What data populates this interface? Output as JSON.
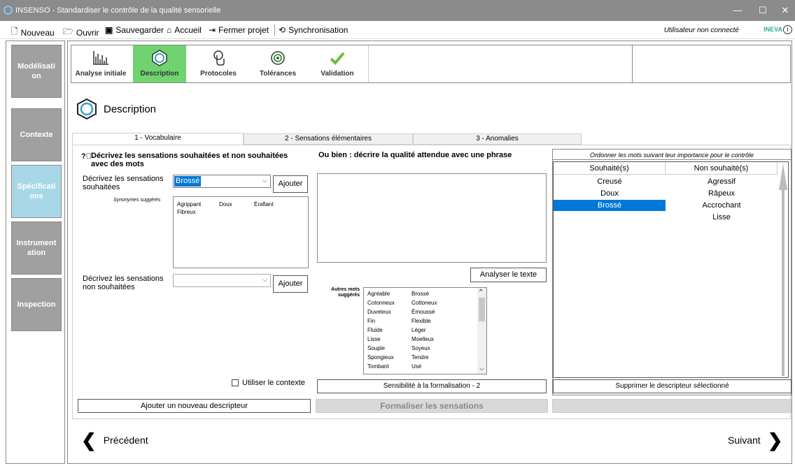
{
  "window": {
    "title": "INSENSO - Standardiser le contrôle de la qualité sensorielle"
  },
  "menu": {
    "new": "Nouveau",
    "open": "Ouvrir",
    "save": "Sauvegarder",
    "home": "Accueil",
    "close_project": "Fermer projet",
    "sync": "Synchronisation",
    "user_status": "Utilisateur non connecté",
    "brand": "INEVA"
  },
  "sidebar": {
    "items": [
      {
        "label": "Modélisati on"
      },
      {
        "label": "Contexte"
      },
      {
        "label": "Spécificati ons"
      },
      {
        "label": "Instrument ation"
      },
      {
        "label": "Inspection"
      }
    ]
  },
  "toolbar": {
    "items": [
      {
        "label": "Analyse initiale",
        "icon": "analysis-icon"
      },
      {
        "label": "Description",
        "icon": "description-icon",
        "active": true
      },
      {
        "label": "Protocoles",
        "icon": "touch-icon"
      },
      {
        "label": "Tolérances",
        "icon": "target-icon"
      },
      {
        "label": "Validation",
        "icon": "check-icon"
      }
    ]
  },
  "page": {
    "title": "Description"
  },
  "tabs": [
    {
      "label": "1 - Vocabulaire",
      "active": true
    },
    {
      "label": "2 - Sensations élémentaires"
    },
    {
      "label": "3 - Anomalies"
    }
  ],
  "vocab": {
    "heading": "Décrivez les sensations souhaitées et non souhaitées avec des mots",
    "desired_label": "Décrivez les sensations souhaitées",
    "desired_value": "Brossé",
    "add_label": "Ajouter",
    "synonyms_label": "Synonymes suggérés",
    "synonyms": [
      "Agrippant",
      "Doux",
      "Éraflant",
      "Fibreux"
    ],
    "undesired_label": "Décrivez les sensations non souhaitées",
    "undesired_value": "",
    "use_context_label": "Utiliser le contexte",
    "add_descriptor_label": "Ajouter un nouveau descripteur"
  },
  "phrase": {
    "heading": "Ou bien : décrire la qualité attendue avec une phrase",
    "text": "",
    "analyze_label": "Analyser le texte",
    "other_words_label": "Autres mots suggérés",
    "other_words": [
      [
        "Agréable",
        "Brossé"
      ],
      [
        "Cotonneux",
        "Cottoneux"
      ],
      [
        "Duveteux",
        "Émoussé"
      ],
      [
        "Fin",
        "Flexible"
      ],
      [
        "Fluide",
        "Léger"
      ],
      [
        "Lisse",
        "Moelleux"
      ],
      [
        "Souple",
        "Soyeux"
      ],
      [
        "Spongieux",
        "Tendre"
      ],
      [
        "Tombant",
        "Usé"
      ]
    ],
    "sensitivity_label": "Sensibilité à la formalisation - 2",
    "formalize_label": "Formaliser les sensations"
  },
  "ordering": {
    "caption": "Ordonner les mots suivant leur importance pour le contrôle",
    "col_desired": "Souhaité(s)",
    "col_undesired": "Non souhaité(s)",
    "desired": [
      "Creusé",
      "Doux",
      "Brossé"
    ],
    "undesired": [
      "Agressif",
      "Râpeux",
      "Accrochant",
      "Lisse"
    ],
    "selected_desired": "Brossé",
    "delete_label": "Supprimer le descripteur sélectionné"
  },
  "nav": {
    "prev": "Précédent",
    "next": "Suivant"
  }
}
